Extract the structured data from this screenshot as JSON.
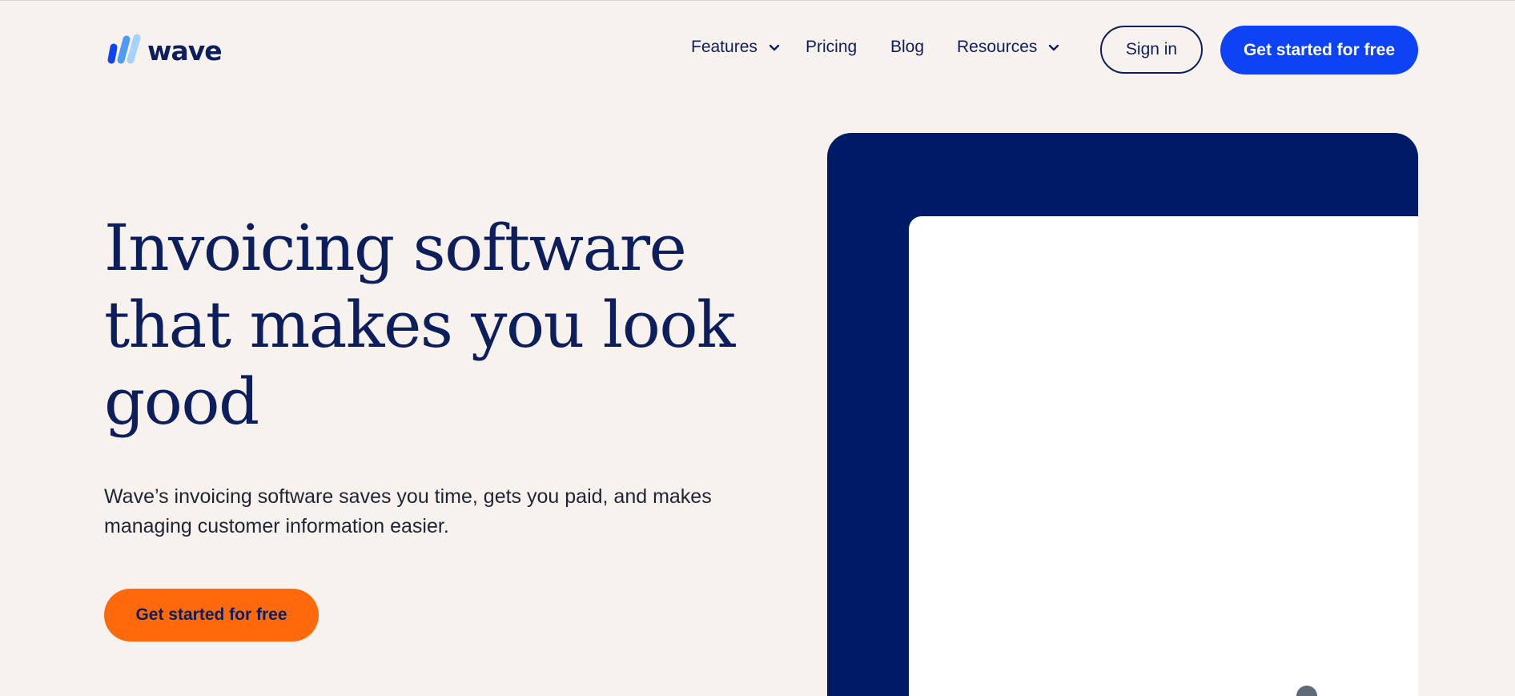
{
  "brand": {
    "name": "wave",
    "logo_icon": "wave-logo-icon",
    "colors": {
      "navy": "#0c1f5c",
      "primary_blue": "#0e42f5",
      "orange": "#fe6a0b",
      "background": "#f8f2ef",
      "panel_navy": "#001a66"
    }
  },
  "nav": {
    "items": [
      {
        "label": "Features",
        "has_dropdown": true
      },
      {
        "label": "Pricing",
        "has_dropdown": false
      },
      {
        "label": "Blog",
        "has_dropdown": false
      },
      {
        "label": "Resources",
        "has_dropdown": true
      }
    ],
    "sign_in_label": "Sign in",
    "cta_label": "Get started for free"
  },
  "hero": {
    "title": "Invoicing software that makes you look good",
    "subtitle": "Wave’s invoicing software saves you time, gets you paid, and makes managing customer information easier.",
    "cta_label": "Get started for free"
  }
}
